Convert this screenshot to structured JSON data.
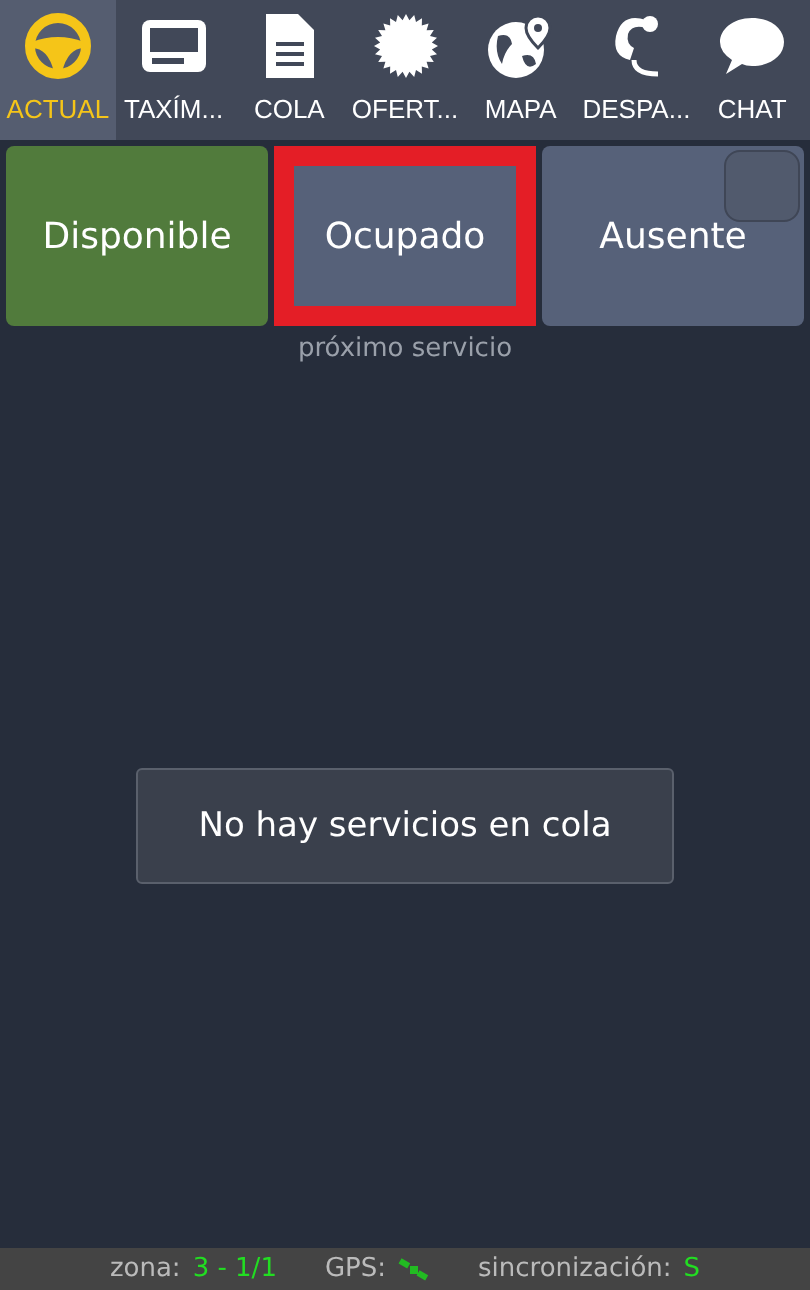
{
  "tabs": [
    {
      "label": "ACTUAL",
      "kind": "wheel",
      "selected": true
    },
    {
      "label": "TAXÍM...",
      "kind": "meter",
      "selected": false
    },
    {
      "label": "COLA",
      "kind": "document",
      "selected": false
    },
    {
      "label": "OFERT...",
      "kind": "seal",
      "selected": false
    },
    {
      "label": "MAPA",
      "kind": "globe",
      "selected": false
    },
    {
      "label": "DESPA...",
      "kind": "headset",
      "selected": false
    },
    {
      "label": "CHAT",
      "kind": "chat",
      "selected": false
    }
  ],
  "status_buttons": [
    {
      "label": "Disponible",
      "selected": true,
      "highlighted": false
    },
    {
      "label": "Ocupado",
      "selected": false,
      "highlighted": true
    },
    {
      "label": "Ausente",
      "selected": false,
      "highlighted": false
    }
  ],
  "next_service_label": "próximo servicio",
  "queue_message": "No hay servicios en cola",
  "status_bar": {
    "zone_label": "zona:",
    "zone_value": "3 - 1/1",
    "gps_label": "GPS:",
    "sync_label": "sincronización:",
    "sync_value": "S"
  }
}
